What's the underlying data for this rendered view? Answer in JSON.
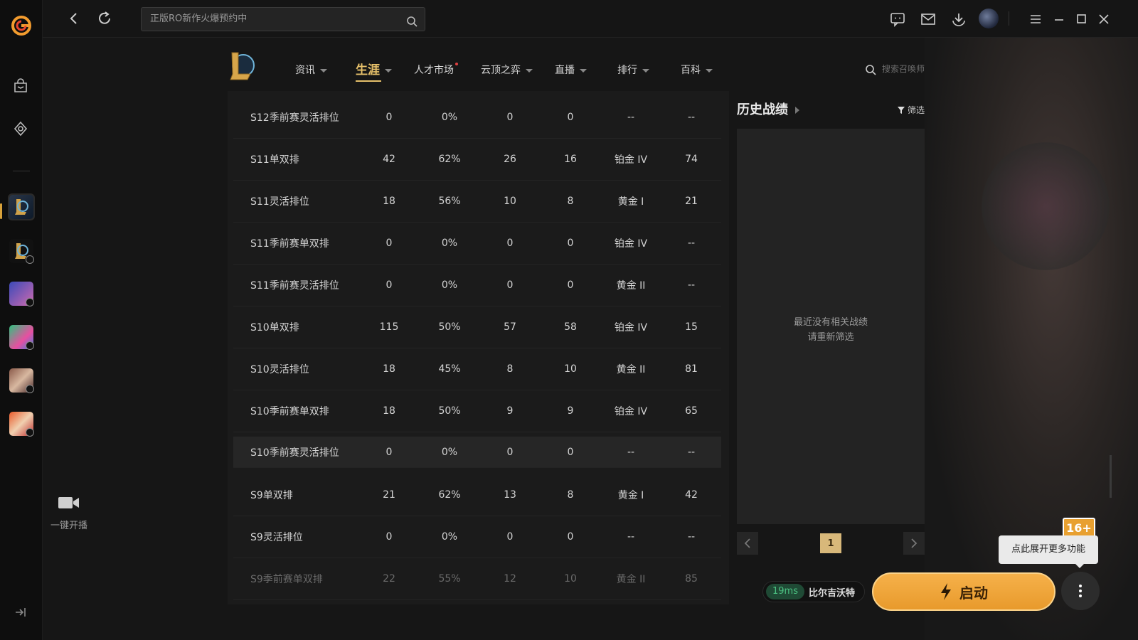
{
  "topbar": {
    "search_placeholder": "正版RO新作火爆预约中"
  },
  "left_rail": {
    "stream_label": "一键开播"
  },
  "game_nav": {
    "items": [
      {
        "label": "资讯"
      },
      {
        "label": "生涯"
      },
      {
        "label": "人才市场"
      },
      {
        "label": "云顶之弈"
      },
      {
        "label": "直播"
      },
      {
        "label": "排行"
      },
      {
        "label": "百科"
      }
    ],
    "summoner_search_placeholder": "搜索召唤师"
  },
  "career_table": {
    "rows": [
      [
        "S12季前赛灵活排位",
        "0",
        "0%",
        "0",
        "0",
        "--",
        "--"
      ],
      [
        "S11单双排",
        "42",
        "62%",
        "26",
        "16",
        "铂金 IV",
        "74"
      ],
      [
        "S11灵活排位",
        "18",
        "56%",
        "10",
        "8",
        "黄金 I",
        "21"
      ],
      [
        "S11季前赛单双排",
        "0",
        "0%",
        "0",
        "0",
        "铂金 IV",
        "--"
      ],
      [
        "S11季前赛灵活排位",
        "0",
        "0%",
        "0",
        "0",
        "黄金 II",
        "--"
      ],
      [
        "S10单双排",
        "115",
        "50%",
        "57",
        "58",
        "铂金 IV",
        "15"
      ],
      [
        "S10灵活排位",
        "18",
        "45%",
        "8",
        "10",
        "黄金 II",
        "81"
      ],
      [
        "S10季前赛单双排",
        "18",
        "50%",
        "9",
        "9",
        "铂金 IV",
        "65"
      ],
      [
        "S10季前赛灵活排位",
        "0",
        "0%",
        "0",
        "0",
        "--",
        "--"
      ],
      [
        "S9单双排",
        "21",
        "62%",
        "13",
        "8",
        "黄金 I",
        "42"
      ],
      [
        "S9灵活排位",
        "0",
        "0%",
        "0",
        "0",
        "--",
        "--"
      ],
      [
        "S9季前赛单双排",
        "22",
        "55%",
        "12",
        "10",
        "黄金 II",
        "85"
      ]
    ]
  },
  "history": {
    "title": "历史战绩",
    "filter_label": "筛选",
    "empty_line1": "最近没有相关战绩",
    "empty_line2": "请重新筛选",
    "page": "1"
  },
  "bottom": {
    "ping": "19ms",
    "server": "比尔吉沃特",
    "launch_label": "启动",
    "tooltip": "点此展开更多功能",
    "age_rating": "16+"
  },
  "colors": {
    "accent_gold": "#e6c06a",
    "launch_orange": "#f0a43a",
    "ping_green": "#4cc383"
  }
}
